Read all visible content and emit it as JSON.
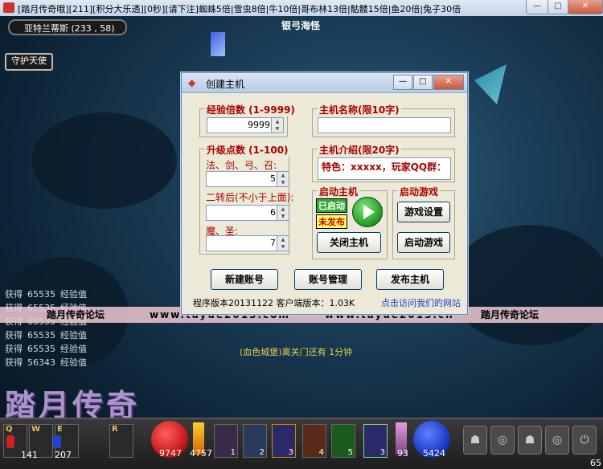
{
  "window": {
    "title": "[踏月传奇哦][211][积分大乐透][0秒][请下注]蜘蛛5倍|雪虫8倍|牛10倍|哥布林13倍|骷髅15倍|鱼20倍|兔子30倍",
    "minimize": "—",
    "maximize": "□",
    "close": "✕"
  },
  "game": {
    "location": "亚特兰蒂斯 (233 , 58)",
    "guard_button": "守护天使",
    "npc_name": "银弓海怪",
    "log": [
      {
        "label": "获得",
        "value": "65535",
        "unit": "经验值"
      },
      {
        "label": "获得",
        "value": "65535",
        "unit": "经验值"
      },
      {
        "label": "获得",
        "value": "65535",
        "unit": "经验值"
      },
      {
        "label": "获得",
        "value": "65535",
        "unit": "经验值"
      },
      {
        "label": "获得",
        "value": "65535",
        "unit": "经验值"
      },
      {
        "label": "获得",
        "value": "56343",
        "unit": "经验值"
      }
    ],
    "banner": [
      "踏月传奇论坛",
      "www.tayue2013.com",
      "www.tayue2013.cn",
      "踏月传奇论坛"
    ],
    "gate_notice": "(血色城堡)离关门还有 1分钟",
    "logo": "踏月传奇",
    "hud": {
      "hotkeys": [
        "Q",
        "W",
        "E",
        "R"
      ],
      "potion_counts": [
        "141",
        "207"
      ],
      "hp": "9747",
      "hp_extra": "4757",
      "skill_counts": [
        "1",
        "2",
        "3",
        "4",
        "5",
        "3"
      ],
      "mp_level": "93",
      "mp": "5424",
      "level": "65"
    },
    "colors": {
      "hp_orb": "#c81c1c",
      "mp_orb": "#1c3cc8",
      "title_accent": "#aa0000"
    }
  },
  "dialog": {
    "title": "创建主机",
    "exp_group": "经验倍数 (1-9999)",
    "exp_value": "9999",
    "host_name_group": "主机名称(限10字)",
    "host_name_value": "",
    "upgrade_group": "升级点数 (1-100)",
    "class1_label": "法、剑、弓、召:",
    "class1_value": "5",
    "class2_label": "二转后(不小于上面):",
    "class2_value": "6",
    "class3_label": "魔、圣:",
    "class3_value": "7",
    "intro_group": "主机介绍(限20字)",
    "intro_value": "特色：xxxxx，玩家QQ群：",
    "start_host_group": "启动主机",
    "status_started": "已启动",
    "status_unpublished": "未发布",
    "close_host_button": "关闭主机",
    "start_game_group": "启动游戏",
    "game_settings_button": "游戏设置",
    "start_game_button": "启动游戏",
    "new_account_button": "新建账号",
    "account_manage_button": "账号管理",
    "publish_host_button": "发布主机",
    "version_text": "程序版本20131122 客户端版本：1.03K",
    "website_link": "点击访问我们的网站"
  }
}
